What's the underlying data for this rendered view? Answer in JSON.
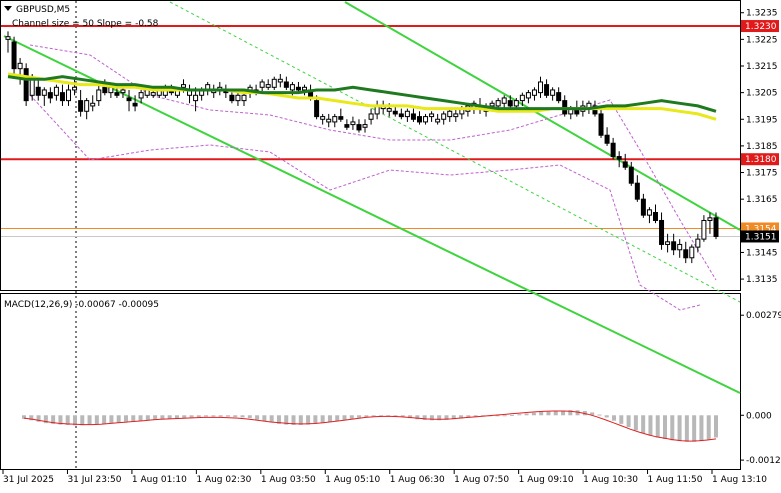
{
  "header": {
    "symbol_title": "GBPUSD,M5",
    "indicator_line": "Channel size = 50 Slope = -0.58"
  },
  "chart_data": {
    "type": "candlestick",
    "price_axis": {
      "ticks": [
        "1.3235",
        "1.3225",
        "1.3215",
        "1.3205",
        "1.3195",
        "1.3185",
        "1.3175",
        "1.3165",
        "1.3145",
        "1.3135"
      ],
      "range": [
        1.31309,
        1.32379
      ]
    },
    "horizontal_levels": [
      {
        "value": 1.323,
        "label": "1.3230",
        "color": "#e01a1a"
      },
      {
        "value": 1.318,
        "label": "1.3180",
        "color": "#e01a1a"
      },
      {
        "value": 1.3154,
        "label": "1.3154",
        "color": "#f08a24"
      },
      {
        "value": 1.3151,
        "label": "1.3151",
        "color": "#000000"
      }
    ],
    "ma_colors": {
      "fast": "#1f7a1f",
      "slow": "#e8e81a"
    },
    "channel_color": "#3dd43d",
    "bollinger_color": "#c060d0",
    "candles": [
      [
        1.3225,
        1.3228,
        1.322,
        1.3226
      ],
      [
        1.3224,
        1.3226,
        1.3212,
        1.3214
      ],
      [
        1.3214,
        1.3218,
        1.3208,
        1.3216
      ],
      [
        1.3214,
        1.3216,
        1.32,
        1.3202
      ],
      [
        1.3204,
        1.3212,
        1.3202,
        1.321
      ],
      [
        1.3207,
        1.321,
        1.3202,
        1.3204
      ],
      [
        1.3204,
        1.3207,
        1.32,
        1.3206
      ],
      [
        1.3205,
        1.3207,
        1.3201,
        1.3203
      ],
      [
        1.3204,
        1.3208,
        1.3202,
        1.3207
      ],
      [
        1.3205,
        1.3208,
        1.32,
        1.3202
      ],
      [
        1.3202,
        1.3208,
        1.32,
        1.3206
      ],
      [
        1.3206,
        1.321,
        1.3204,
        1.3207
      ],
      [
        1.3202,
        1.3206,
        1.3196,
        1.3198
      ],
      [
        1.3198,
        1.3203,
        1.3195,
        1.3202
      ],
      [
        1.32,
        1.3204,
        1.3198,
        1.3201
      ],
      [
        1.3202,
        1.3208,
        1.32,
        1.3206
      ],
      [
        1.3207,
        1.321,
        1.3204,
        1.3205
      ],
      [
        1.3205,
        1.3208,
        1.3203,
        1.3207
      ],
      [
        1.3205,
        1.3208,
        1.3203,
        1.3204
      ],
      [
        1.3205,
        1.3208,
        1.3203,
        1.3206
      ],
      [
        1.3203,
        1.3206,
        1.3198,
        1.3202
      ],
      [
        1.3201,
        1.3204,
        1.3198,
        1.32
      ],
      [
        1.3203,
        1.3206,
        1.3201,
        1.3205
      ],
      [
        1.3204,
        1.3207,
        1.3203,
        1.3206
      ],
      [
        1.3204,
        1.3207,
        1.3203,
        1.3205
      ],
      [
        1.3204,
        1.3207,
        1.3203,
        1.3206
      ],
      [
        1.3204,
        1.3208,
        1.3203,
        1.3207
      ],
      [
        1.3206,
        1.3208,
        1.3204,
        1.3205
      ],
      [
        1.3204,
        1.3207,
        1.3203,
        1.3206
      ],
      [
        1.3207,
        1.321,
        1.3205,
        1.3208
      ],
      [
        1.3204,
        1.3208,
        1.3201,
        1.3206
      ],
      [
        1.3202,
        1.3207,
        1.3198,
        1.3204
      ],
      [
        1.3204,
        1.3207,
        1.3202,
        1.3206
      ],
      [
        1.3206,
        1.3209,
        1.3204,
        1.3208
      ],
      [
        1.3205,
        1.3208,
        1.3203,
        1.3206
      ],
      [
        1.3206,
        1.3209,
        1.3204,
        1.3207
      ],
      [
        1.3206,
        1.3208,
        1.3203,
        1.3205
      ],
      [
        1.3204,
        1.3206,
        1.3201,
        1.3202
      ],
      [
        1.3202,
        1.3205,
        1.32,
        1.3204
      ],
      [
        1.3202,
        1.3206,
        1.32,
        1.3204
      ],
      [
        1.3205,
        1.3208,
        1.3203,
        1.3207
      ],
      [
        1.3206,
        1.3208,
        1.3204,
        1.3206
      ],
      [
        1.3207,
        1.321,
        1.3205,
        1.3209
      ],
      [
        1.3207,
        1.321,
        1.3206,
        1.3208
      ],
      [
        1.3207,
        1.3211,
        1.3206,
        1.321
      ],
      [
        1.3209,
        1.3212,
        1.3207,
        1.321
      ],
      [
        1.3209,
        1.3211,
        1.3206,
        1.3207
      ],
      [
        1.3206,
        1.3209,
        1.3204,
        1.3208
      ],
      [
        1.3207,
        1.3209,
        1.3205,
        1.3206
      ],
      [
        1.3206,
        1.3208,
        1.3204,
        1.3207
      ],
      [
        1.3206,
        1.3208,
        1.3202,
        1.3203
      ],
      [
        1.3202,
        1.3204,
        1.3195,
        1.3196
      ],
      [
        1.3195,
        1.3197,
        1.3193,
        1.3196
      ],
      [
        1.3194,
        1.3197,
        1.3192,
        1.3195
      ],
      [
        1.3194,
        1.3197,
        1.3192,
        1.3196
      ],
      [
        1.3196,
        1.3199,
        1.3194,
        1.3195
      ],
      [
        1.3193,
        1.3195,
        1.3191,
        1.3192
      ],
      [
        1.3193,
        1.3196,
        1.3191,
        1.3194
      ],
      [
        1.3193,
        1.3195,
        1.319,
        1.3191
      ],
      [
        1.3192,
        1.3195,
        1.319,
        1.3193
      ],
      [
        1.3195,
        1.3199,
        1.3193,
        1.3197
      ],
      [
        1.3197,
        1.3202,
        1.3195,
        1.32
      ],
      [
        1.3199,
        1.3202,
        1.3197,
        1.32
      ],
      [
        1.3198,
        1.3201,
        1.3196,
        1.3199
      ],
      [
        1.3198,
        1.32,
        1.3196,
        1.3197
      ],
      [
        1.3197,
        1.3199,
        1.3195,
        1.3196
      ],
      [
        1.3196,
        1.3199,
        1.3194,
        1.3198
      ],
      [
        1.3197,
        1.3199,
        1.3194,
        1.3195
      ],
      [
        1.3196,
        1.3198,
        1.3193,
        1.3194
      ],
      [
        1.3194,
        1.3197,
        1.3193,
        1.3196
      ],
      [
        1.3196,
        1.3198,
        1.3194,
        1.3197
      ],
      [
        1.3194,
        1.3197,
        1.3193,
        1.3195
      ],
      [
        1.3195,
        1.3198,
        1.3193,
        1.3197
      ],
      [
        1.3196,
        1.3199,
        1.3194,
        1.3198
      ],
      [
        1.3196,
        1.3199,
        1.3194,
        1.3197
      ],
      [
        1.3197,
        1.32,
        1.3195,
        1.3199
      ],
      [
        1.3198,
        1.3201,
        1.3196,
        1.32
      ],
      [
        1.3199,
        1.3202,
        1.3197,
        1.3201
      ],
      [
        1.32,
        1.3203,
        1.3197,
        1.3199
      ],
      [
        1.3198,
        1.3201,
        1.3196,
        1.32
      ],
      [
        1.32,
        1.3202,
        1.3198,
        1.3201
      ],
      [
        1.32,
        1.3203,
        1.3198,
        1.3202
      ],
      [
        1.3201,
        1.3204,
        1.3199,
        1.3203
      ],
      [
        1.3202,
        1.3204,
        1.3199,
        1.32
      ],
      [
        1.32,
        1.3203,
        1.3198,
        1.3202
      ],
      [
        1.3202,
        1.3205,
        1.32,
        1.3204
      ],
      [
        1.3203,
        1.3206,
        1.3201,
        1.3205
      ],
      [
        1.3204,
        1.3207,
        1.3202,
        1.3206
      ],
      [
        1.3205,
        1.3211,
        1.3203,
        1.3209
      ],
      [
        1.3208,
        1.321,
        1.3203,
        1.3204
      ],
      [
        1.3204,
        1.3207,
        1.3202,
        1.3206
      ],
      [
        1.3205,
        1.3207,
        1.3201,
        1.3202
      ],
      [
        1.3202,
        1.3204,
        1.3196,
        1.3197
      ],
      [
        1.3197,
        1.32,
        1.3195,
        1.3199
      ],
      [
        1.3199,
        1.3202,
        1.3196,
        1.3197
      ],
      [
        1.3198,
        1.3202,
        1.3196,
        1.32
      ],
      [
        1.3199,
        1.3202,
        1.3197,
        1.3201
      ],
      [
        1.32,
        1.3202,
        1.3196,
        1.3197
      ],
      [
        1.3197,
        1.3199,
        1.3188,
        1.3189
      ],
      [
        1.3189,
        1.3192,
        1.3185,
        1.3186
      ],
      [
        1.3186,
        1.3188,
        1.318,
        1.3181
      ],
      [
        1.3181,
        1.3183,
        1.3177,
        1.318
      ],
      [
        1.3179,
        1.3182,
        1.3176,
        1.3177
      ],
      [
        1.3177,
        1.3179,
        1.317,
        1.3171
      ],
      [
        1.3171,
        1.3174,
        1.3164,
        1.3165
      ],
      [
        1.3165,
        1.3167,
        1.3158,
        1.3159
      ],
      [
        1.3159,
        1.3162,
        1.3156,
        1.3161
      ],
      [
        1.316,
        1.3163,
        1.3156,
        1.3157
      ],
      [
        1.3157,
        1.316,
        1.3146,
        1.3148
      ],
      [
        1.3148,
        1.3152,
        1.3145,
        1.3149
      ],
      [
        1.3149,
        1.3152,
        1.3144,
        1.3146
      ],
      [
        1.3146,
        1.315,
        1.3143,
        1.3148
      ],
      [
        1.3146,
        1.3149,
        1.3141,
        1.3143
      ],
      [
        1.3143,
        1.3148,
        1.3141,
        1.3147
      ],
      [
        1.3147,
        1.3152,
        1.3145,
        1.315
      ],
      [
        1.315,
        1.3159,
        1.3149,
        1.3157
      ],
      [
        1.3157,
        1.316,
        1.3152,
        1.3158
      ],
      [
        1.3158,
        1.316,
        1.315,
        1.3151
      ]
    ],
    "fast_ma": [
      1.3211,
      1.321,
      1.321,
      1.3211,
      1.321,
      1.3209,
      1.3208,
      1.3208,
      1.3207,
      1.3207,
      1.3206,
      1.3206,
      1.3206,
      1.3206,
      1.3205,
      1.3205,
      1.3205,
      1.3206,
      1.3206,
      1.3207,
      1.3206,
      1.3205,
      1.3204,
      1.3203,
      1.3202,
      1.3201,
      1.32,
      1.3199,
      1.3199,
      1.3199,
      1.3199,
      1.3199,
      1.3199,
      1.32,
      1.32,
      1.3201,
      1.3202,
      1.3201,
      1.32,
      1.3198
    ],
    "slow_ma": [
      1.3212,
      1.3211,
      1.321,
      1.3209,
      1.3208,
      1.3208,
      1.3207,
      1.3207,
      1.3206,
      1.3206,
      1.3206,
      1.3206,
      1.3206,
      1.3205,
      1.3205,
      1.3204,
      1.3203,
      1.3203,
      1.3202,
      1.3201,
      1.32,
      1.32,
      1.32,
      1.3199,
      1.3199,
      1.3199,
      1.3199,
      1.3198,
      1.3198,
      1.3198,
      1.3199,
      1.3199,
      1.3199,
      1.3199,
      1.3199,
      1.3199,
      1.3199,
      1.3198,
      1.3197,
      1.3195
    ]
  },
  "macd": {
    "label": "MACD(12,26,9) -0.00067 -0.00095",
    "ticks": [
      "0.00279",
      "0.000",
      "-0.00125"
    ],
    "range": [
      -0.00147,
      0.00327
    ],
    "histogram": [
      -0.0001,
      -0.00014,
      -0.00018,
      -0.00022,
      -0.00024,
      -0.00026,
      -0.00027,
      -0.00028,
      -0.00028,
      -0.00027,
      -0.00026,
      -0.00024,
      -0.00022,
      -0.0002,
      -0.00018,
      -0.00016,
      -0.00015,
      -0.00013,
      -0.00012,
      -0.00011,
      -0.0001,
      -9e-05,
      -8e-05,
      -6e-05,
      -5e-05,
      -4e-05,
      -4e-05,
      -4e-05,
      -4e-05,
      -5e-05,
      -6e-05,
      -8e-05,
      -0.00012,
      -0.00016,
      -0.0002,
      -0.00024,
      -0.00026,
      -0.00027,
      -0.00027,
      -0.00026,
      -0.00024,
      -0.00022,
      -0.00019,
      -0.00016,
      -0.00013,
      -0.0001,
      -7e-05,
      -5e-05,
      -3e-05,
      -2e-05,
      -2e-05,
      -3e-05,
      -5e-05,
      -8e-05,
      -0.00011,
      -0.00013,
      -0.00014,
      -0.00014,
      -0.00013,
      -0.00011,
      -9e-05,
      -7e-05,
      -5e-05,
      -3e-05,
      -2e-05,
      -1e-05,
      0.0,
      1e-05,
      3e-05,
      5e-05,
      7e-05,
      9e-05,
      0.0001,
      0.00012,
      0.00013,
      0.00014,
      0.00014,
      0.00012,
      8e-05,
      2e-05,
      -6e-05,
      -0.00015,
      -0.00024,
      -0.00033,
      -0.00042,
      -0.0005,
      -0.00057,
      -0.00062,
      -0.00066,
      -0.0007,
      -0.00072,
      -0.00074,
      -0.00074,
      -0.00072,
      -0.00068,
      -0.00062
    ],
    "signal": [
      -8e-05,
      -0.00011,
      -0.00015,
      -0.00019,
      -0.00022,
      -0.00024,
      -0.00025,
      -0.00026,
      -0.00026,
      -0.00025,
      -0.00023,
      -0.00021,
      -0.00019,
      -0.00017,
      -0.00015,
      -0.00013,
      -0.00011,
      -0.0001,
      -9e-05,
      -8e-05,
      -7e-05,
      -6e-05,
      -6e-05,
      -6e-05,
      -7e-05,
      -8e-05,
      -0.0001,
      -0.00013,
      -0.00016,
      -0.00019,
      -0.00021,
      -0.00023,
      -0.00024,
      -0.00024,
      -0.00023,
      -0.00021,
      -0.00018,
      -0.00015,
      -0.00012,
      -9e-05,
      -6e-05,
      -4e-05,
      -3e-05,
      -3e-05,
      -4e-05,
      -6e-05,
      -8e-05,
      -0.0001,
      -0.00011,
      -0.00011,
      -0.0001,
      -8e-05,
      -6e-05,
      -4e-05,
      -2e-05,
      0.0,
      2e-05,
      4e-05,
      6e-05,
      8e-05,
      0.0001,
      0.00011,
      0.00012,
      0.00012,
      0.00011,
      8e-05,
      3e-05,
      -4e-05,
      -0.00012,
      -0.00021,
      -0.0003,
      -0.00039,
      -0.00047,
      -0.00054,
      -0.0006,
      -0.00064,
      -0.00068,
      -0.00071,
      -0.00072,
      -0.00071,
      -0.00069,
      -0.00066
    ]
  },
  "time_axis": {
    "labels": [
      "31 Jul 2025",
      "31 Jul 23:50",
      "1 Aug 01:10",
      "1 Aug 02:30",
      "1 Aug 03:50",
      "1 Aug 05:10",
      "1 Aug 06:30",
      "1 Aug 07:50",
      "1 Aug 09:10",
      "1 Aug 10:30",
      "1 Aug 11:50",
      "1 Aug 13:10"
    ]
  }
}
